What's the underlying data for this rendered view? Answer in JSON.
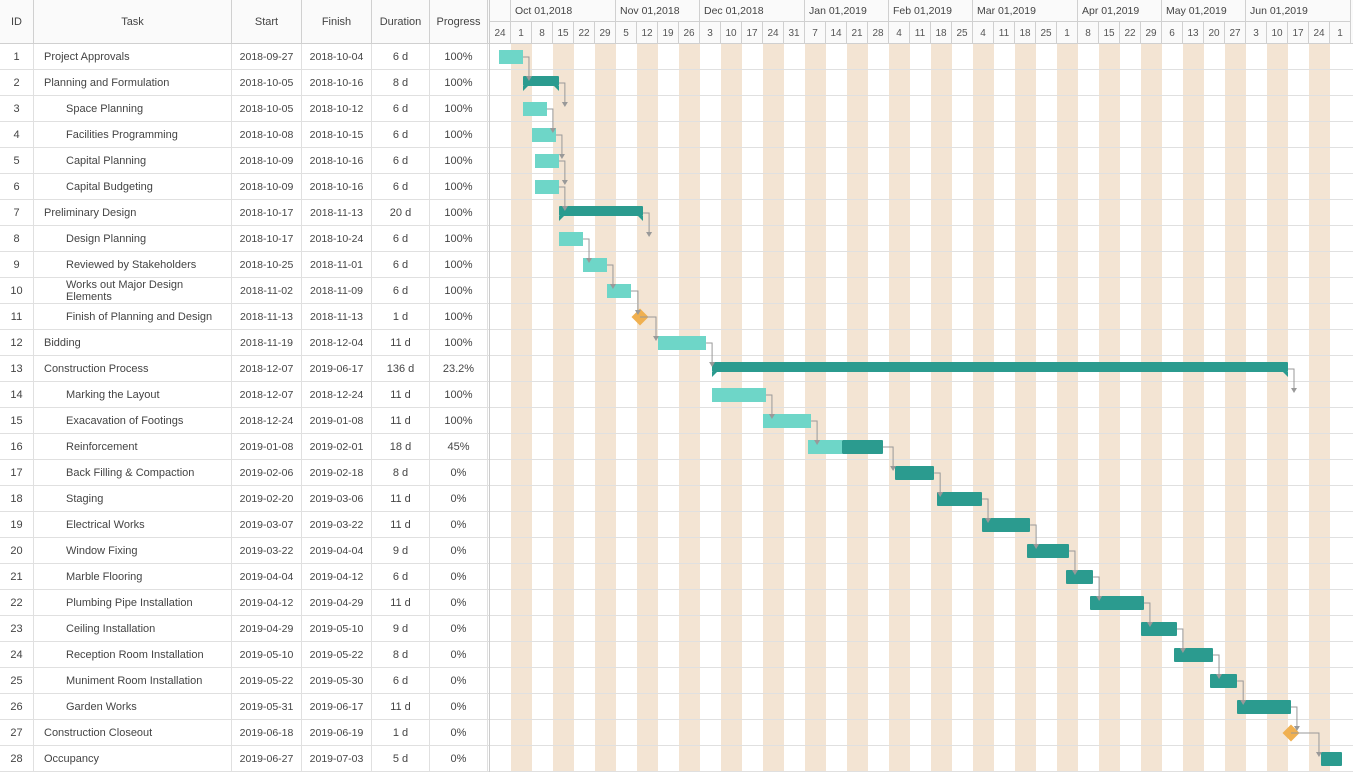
{
  "chart_data": {
    "type": "gantt",
    "columns": [
      "ID",
      "Task",
      "Start",
      "Finish",
      "Duration",
      "Progress"
    ],
    "start_date": "2018-09-24",
    "end_date": "2019-07-04",
    "months": [
      {
        "label": "",
        "days": 1
      },
      {
        "label": "Oct 01,2018",
        "days": 5
      },
      {
        "label": "Nov 01,2018",
        "days": 4
      },
      {
        "label": "Dec 01,2018",
        "days": 5
      },
      {
        "label": "Jan 01,2019",
        "days": 4
      },
      {
        "label": "Feb 01,2019",
        "days": 4
      },
      {
        "label": "Mar 01,2019",
        "days": 5
      },
      {
        "label": "Apr 01,2019",
        "days": 4
      },
      {
        "label": "May 01,2019",
        "days": 4
      },
      {
        "label": "Jun 01,2019",
        "days": 5
      }
    ],
    "day_labels": [
      "24",
      "1",
      "8",
      "15",
      "22",
      "29",
      "5",
      "12",
      "19",
      "26",
      "3",
      "10",
      "17",
      "24",
      "31",
      "7",
      "14",
      "21",
      "28",
      "4",
      "11",
      "18",
      "25",
      "4",
      "11",
      "18",
      "25",
      "1",
      "8",
      "15",
      "22",
      "29",
      "6",
      "13",
      "20",
      "27",
      "3",
      "10",
      "17",
      "24",
      "1"
    ],
    "tasks": [
      {
        "id": 1,
        "name": "Project Approvals",
        "start": "2018-09-27",
        "finish": "2018-10-04",
        "duration": "6 d",
        "progress": "100%",
        "indent": 0,
        "type": "task",
        "from_col": 0.43,
        "width_cols": 1.14,
        "pct": 100
      },
      {
        "id": 2,
        "name": "Planning and Formulation",
        "start": "2018-10-05",
        "finish": "2018-10-16",
        "duration": "8 d",
        "progress": "100%",
        "indent": 0,
        "type": "summary",
        "from_col": 1.57,
        "width_cols": 1.71,
        "pct": 100
      },
      {
        "id": 3,
        "name": "Space Planning",
        "start": "2018-10-05",
        "finish": "2018-10-12",
        "duration": "6 d",
        "progress": "100%",
        "indent": 1,
        "type": "task",
        "from_col": 1.57,
        "width_cols": 1.14,
        "pct": 100
      },
      {
        "id": 4,
        "name": "Facilities Programming",
        "start": "2018-10-08",
        "finish": "2018-10-15",
        "duration": "6 d",
        "progress": "100%",
        "indent": 1,
        "type": "task",
        "from_col": 2.0,
        "width_cols": 1.14,
        "pct": 100
      },
      {
        "id": 5,
        "name": "Capital Planning",
        "start": "2018-10-09",
        "finish": "2018-10-16",
        "duration": "6 d",
        "progress": "100%",
        "indent": 1,
        "type": "task",
        "from_col": 2.14,
        "width_cols": 1.14,
        "pct": 100
      },
      {
        "id": 6,
        "name": "Capital Budgeting",
        "start": "2018-10-09",
        "finish": "2018-10-16",
        "duration": "6 d",
        "progress": "100%",
        "indent": 1,
        "type": "task",
        "from_col": 2.14,
        "width_cols": 1.14,
        "pct": 100
      },
      {
        "id": 7,
        "name": "Preliminary Design",
        "start": "2018-10-17",
        "finish": "2018-11-13",
        "duration": "20 d",
        "progress": "100%",
        "indent": 0,
        "type": "summary",
        "from_col": 3.29,
        "width_cols": 4.0,
        "pct": 100
      },
      {
        "id": 8,
        "name": "Design Planning",
        "start": "2018-10-17",
        "finish": "2018-10-24",
        "duration": "6 d",
        "progress": "100%",
        "indent": 1,
        "type": "task",
        "from_col": 3.29,
        "width_cols": 1.14,
        "pct": 100
      },
      {
        "id": 9,
        "name": "Reviewed by Stakeholders",
        "start": "2018-10-25",
        "finish": "2018-11-01",
        "duration": "6 d",
        "progress": "100%",
        "indent": 1,
        "type": "task",
        "from_col": 4.43,
        "width_cols": 1.14,
        "pct": 100
      },
      {
        "id": 10,
        "name": "Works out Major Design Elements",
        "start": "2018-11-02",
        "finish": "2018-11-09",
        "duration": "6 d",
        "progress": "100%",
        "indent": 1,
        "type": "task",
        "from_col": 5.57,
        "width_cols": 1.14,
        "pct": 100
      },
      {
        "id": 11,
        "name": "Finish of Planning and Design",
        "start": "2018-11-13",
        "finish": "2018-11-13",
        "duration": "1 d",
        "progress": "100%",
        "indent": 1,
        "type": "milestone",
        "from_col": 7.14,
        "width_cols": 0,
        "pct": 100
      },
      {
        "id": 12,
        "name": "Bidding",
        "start": "2018-11-19",
        "finish": "2018-12-04",
        "duration": "11 d",
        "progress": "100%",
        "indent": 0,
        "type": "task",
        "from_col": 8.0,
        "width_cols": 2.29,
        "pct": 100
      },
      {
        "id": 13,
        "name": "Construction Process",
        "start": "2018-12-07",
        "finish": "2019-06-17",
        "duration": "136 d",
        "progress": "23.2%",
        "indent": 0,
        "type": "summary",
        "from_col": 10.57,
        "width_cols": 27.43,
        "pct": 23.2
      },
      {
        "id": 14,
        "name": "Marking the Layout",
        "start": "2018-12-07",
        "finish": "2018-12-24",
        "duration": "11 d",
        "progress": "100%",
        "indent": 1,
        "type": "task",
        "from_col": 10.57,
        "width_cols": 2.57,
        "pct": 100
      },
      {
        "id": 15,
        "name": "Exacavation of Footings",
        "start": "2018-12-24",
        "finish": "2019-01-08",
        "duration": "11 d",
        "progress": "100%",
        "indent": 1,
        "type": "task",
        "from_col": 13.0,
        "width_cols": 2.29,
        "pct": 100
      },
      {
        "id": 16,
        "name": "Reinforcement",
        "start": "2019-01-08",
        "finish": "2019-02-01",
        "duration": "18 d",
        "progress": "45%",
        "indent": 1,
        "type": "task",
        "from_col": 15.14,
        "width_cols": 3.57,
        "pct": 45
      },
      {
        "id": 17,
        "name": "Back Filling & Compaction",
        "start": "2019-02-06",
        "finish": "2019-02-18",
        "duration": "8 d",
        "progress": "0%",
        "indent": 1,
        "type": "task",
        "from_col": 19.29,
        "width_cols": 1.86,
        "pct": 0
      },
      {
        "id": 18,
        "name": "Staging",
        "start": "2019-02-20",
        "finish": "2019-03-06",
        "duration": "11 d",
        "progress": "0%",
        "indent": 1,
        "type": "task",
        "from_col": 21.29,
        "width_cols": 2.14,
        "pct": 0
      },
      {
        "id": 19,
        "name": "Electrical Works",
        "start": "2019-03-07",
        "finish": "2019-03-22",
        "duration": "11 d",
        "progress": "0%",
        "indent": 1,
        "type": "task",
        "from_col": 23.43,
        "width_cols": 2.29,
        "pct": 0
      },
      {
        "id": 20,
        "name": "Window Fixing",
        "start": "2019-03-22",
        "finish": "2019-04-04",
        "duration": "9 d",
        "progress": "0%",
        "indent": 1,
        "type": "task",
        "from_col": 25.57,
        "width_cols": 2.0,
        "pct": 0
      },
      {
        "id": 21,
        "name": "Marble Flooring",
        "start": "2019-04-04",
        "finish": "2019-04-12",
        "duration": "6 d",
        "progress": "0%",
        "indent": 1,
        "type": "task",
        "from_col": 27.43,
        "width_cols": 1.29,
        "pct": 0
      },
      {
        "id": 22,
        "name": "Plumbing Pipe Installation",
        "start": "2019-04-12",
        "finish": "2019-04-29",
        "duration": "11 d",
        "progress": "0%",
        "indent": 1,
        "type": "task",
        "from_col": 28.57,
        "width_cols": 2.57,
        "pct": 0
      },
      {
        "id": 23,
        "name": "Ceiling Installation",
        "start": "2019-04-29",
        "finish": "2019-05-10",
        "duration": "9 d",
        "progress": "0%",
        "indent": 1,
        "type": "task",
        "from_col": 31.0,
        "width_cols": 1.71,
        "pct": 0
      },
      {
        "id": 24,
        "name": "Reception Room Installation",
        "start": "2019-05-10",
        "finish": "2019-05-22",
        "duration": "8 d",
        "progress": "0%",
        "indent": 1,
        "type": "task",
        "from_col": 32.57,
        "width_cols": 1.86,
        "pct": 0
      },
      {
        "id": 25,
        "name": "Muniment Room Installation",
        "start": "2019-05-22",
        "finish": "2019-05-30",
        "duration": "6 d",
        "progress": "0%",
        "indent": 1,
        "type": "task",
        "from_col": 34.29,
        "width_cols": 1.29,
        "pct": 0
      },
      {
        "id": 26,
        "name": "Garden Works",
        "start": "2019-05-31",
        "finish": "2019-06-17",
        "duration": "11 d",
        "progress": "0%",
        "indent": 1,
        "type": "task",
        "from_col": 35.57,
        "width_cols": 2.57,
        "pct": 0
      },
      {
        "id": 27,
        "name": "Construction Closeout",
        "start": "2019-06-18",
        "finish": "2019-06-19",
        "duration": "1 d",
        "progress": "0%",
        "indent": 0,
        "type": "milestone",
        "from_col": 38.14,
        "width_cols": 0,
        "pct": 0
      },
      {
        "id": 28,
        "name": "Occupancy",
        "start": "2019-06-27",
        "finish": "2019-07-03",
        "duration": "5 d",
        "progress": "0%",
        "indent": 0,
        "type": "task",
        "from_col": 39.57,
        "width_cols": 1.0,
        "pct": 0
      }
    ],
    "dependencies": [
      [
        1,
        2
      ],
      [
        2,
        3
      ],
      [
        3,
        4
      ],
      [
        4,
        5
      ],
      [
        5,
        6
      ],
      [
        6,
        7
      ],
      [
        7,
        8
      ],
      [
        8,
        9
      ],
      [
        9,
        10
      ],
      [
        10,
        11
      ],
      [
        11,
        12
      ],
      [
        12,
        13
      ],
      [
        13,
        14
      ],
      [
        14,
        15
      ],
      [
        15,
        16
      ],
      [
        16,
        17
      ],
      [
        17,
        18
      ],
      [
        18,
        19
      ],
      [
        19,
        20
      ],
      [
        20,
        21
      ],
      [
        21,
        22
      ],
      [
        22,
        23
      ],
      [
        23,
        24
      ],
      [
        24,
        25
      ],
      [
        25,
        26
      ],
      [
        26,
        27
      ],
      [
        27,
        28
      ]
    ]
  },
  "headers": {
    "id": "ID",
    "task": "Task",
    "start": "Start",
    "finish": "Finish",
    "duration": "Duration",
    "progress": "Progress"
  }
}
